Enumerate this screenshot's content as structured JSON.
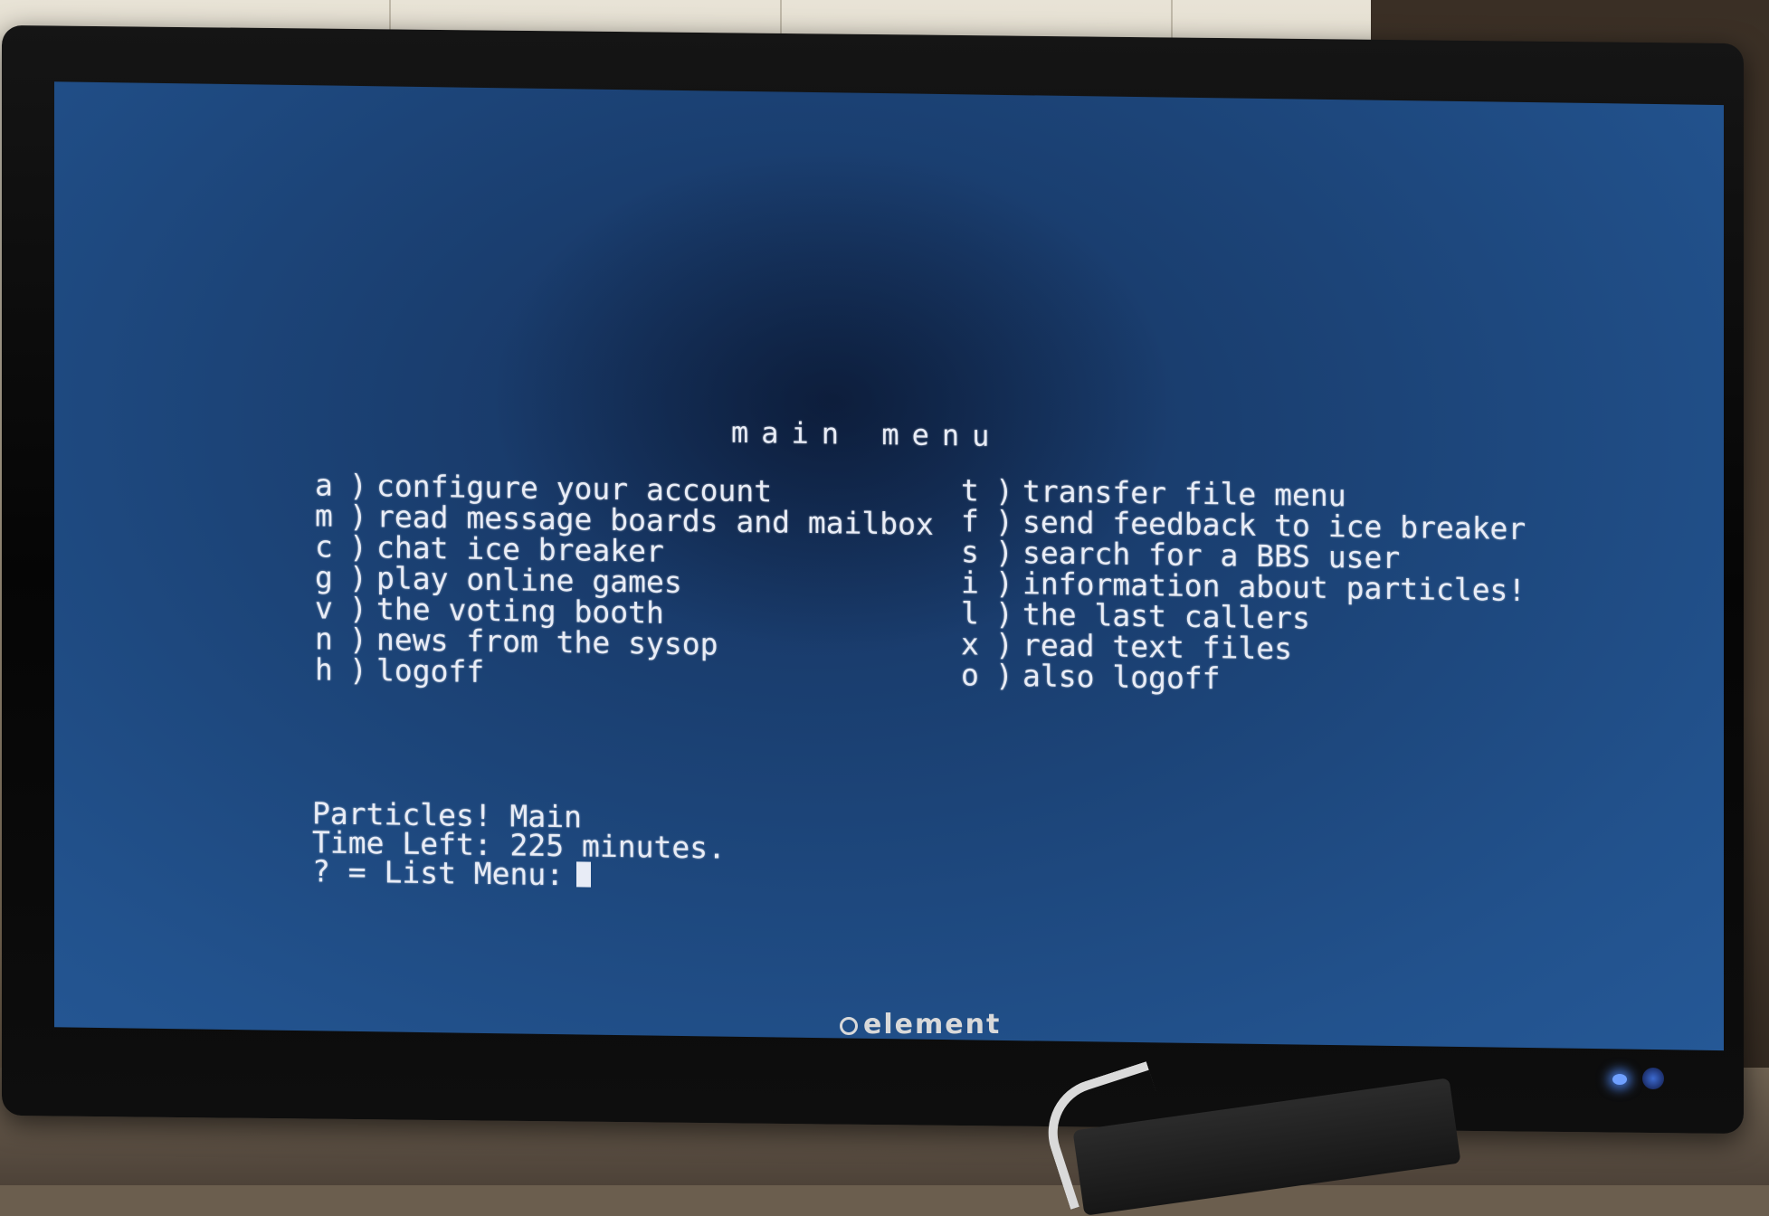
{
  "device": {
    "brand": "element"
  },
  "screen": {
    "title": "main menu",
    "left_menu": [
      {
        "key": "a",
        "label": "configure your account"
      },
      {
        "key": "m",
        "label": "read message boards and mailbox"
      },
      {
        "key": "c",
        "label": "chat ice breaker"
      },
      {
        "key": "g",
        "label": "play online games"
      },
      {
        "key": "v",
        "label": "the voting booth"
      },
      {
        "key": "n",
        "label": "news from the sysop"
      },
      {
        "key": "h",
        "label": "logoff"
      }
    ],
    "right_menu": [
      {
        "key": "t",
        "label": "transfer file menu"
      },
      {
        "key": "f",
        "label": "send feedback to ice breaker"
      },
      {
        "key": "s",
        "label": "search for a BBS user"
      },
      {
        "key": "i",
        "label": "information about particles!"
      },
      {
        "key": "l",
        "label": "the last callers"
      },
      {
        "key": "x",
        "label": "read text files"
      },
      {
        "key": "o",
        "label": "also logoff"
      }
    ],
    "separator": ")",
    "status": {
      "location": "Particles! Main",
      "time_left": "Time Left: 225 minutes.",
      "prompt": "? = List Menu:"
    }
  },
  "colors": {
    "screen_bg": "#1c4478",
    "text": "#e8ecf6",
    "power_led": "#6fa0ff"
  }
}
